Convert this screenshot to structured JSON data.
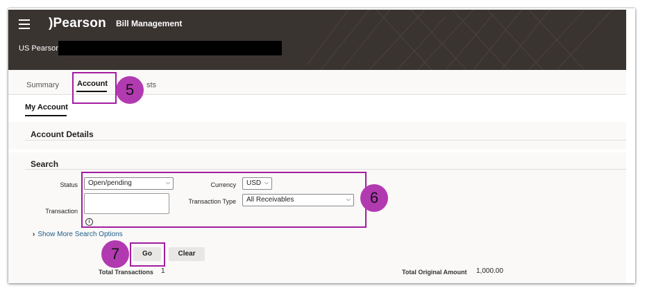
{
  "header": {
    "brand": "Pearson",
    "app_title": "Bill Management",
    "organization": "US Pearson"
  },
  "tabs": [
    {
      "label": "Summary"
    },
    {
      "label": "Account"
    },
    {
      "label": "sts"
    }
  ],
  "subtab": "My Account",
  "sections": {
    "account_details": "Account Details",
    "search": "Search"
  },
  "search": {
    "status_label": "Status",
    "status_value": "Open/pending",
    "currency_label": "Currency",
    "currency_value": "USD",
    "transaction_label": "Transaction",
    "transaction_type_label": "Transaction Type",
    "transaction_type_value": "All Receivables",
    "more_options": "Show More Search Options",
    "go": "Go",
    "clear": "Clear"
  },
  "totals": {
    "transactions_label": "Total Transactions",
    "transactions_value": "1",
    "original_amount_label": "Total Original Amount",
    "original_amount_value": "1,000.00"
  },
  "callouts": [
    "5",
    "6",
    "7"
  ],
  "colors": {
    "header_bg": "#3a3431",
    "highlight": "#a21ca0",
    "badge": "#b23ab0",
    "link": "#1f5c87"
  }
}
